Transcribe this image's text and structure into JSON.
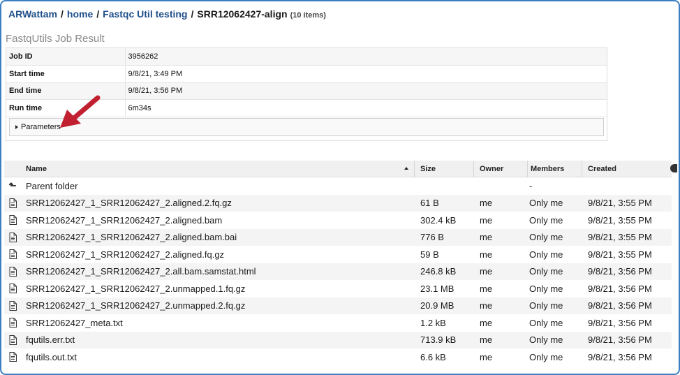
{
  "breadcrumb": {
    "user": "ARWattam",
    "sep": "/",
    "home": "home",
    "folder": "Fastqc Util testing",
    "current": "SRR12062427-align",
    "count": "(10 items)"
  },
  "job": {
    "title": "FastqUtils Job Result",
    "rows": [
      {
        "label": "Job ID",
        "value": "3956262"
      },
      {
        "label": "Start time",
        "value": "9/8/21, 3:49 PM"
      },
      {
        "label": "End time",
        "value": "9/8/21, 3:56 PM"
      },
      {
        "label": "Run time",
        "value": "6m34s"
      }
    ],
    "parameters_label": "Parameters"
  },
  "grid": {
    "headers": {
      "name": "Name",
      "size": "Size",
      "owner": "Owner",
      "members": "Members",
      "created": "Created"
    },
    "parent": {
      "name": "Parent folder",
      "members": "-"
    },
    "files": [
      {
        "name": "SRR12062427_1_SRR12062427_2.aligned.2.fq.gz",
        "size": "61 B",
        "owner": "me",
        "members": "Only me",
        "created": "9/8/21, 3:55 PM"
      },
      {
        "name": "SRR12062427_1_SRR12062427_2.aligned.bam",
        "size": "302.4 kB",
        "owner": "me",
        "members": "Only me",
        "created": "9/8/21, 3:55 PM"
      },
      {
        "name": "SRR12062427_1_SRR12062427_2.aligned.bam.bai",
        "size": "776 B",
        "owner": "me",
        "members": "Only me",
        "created": "9/8/21, 3:55 PM"
      },
      {
        "name": "SRR12062427_1_SRR12062427_2.aligned.fq.gz",
        "size": "59 B",
        "owner": "me",
        "members": "Only me",
        "created": "9/8/21, 3:55 PM"
      },
      {
        "name": "SRR12062427_1_SRR12062427_2.all.bam.samstat.html",
        "size": "246.8 kB",
        "owner": "me",
        "members": "Only me",
        "created": "9/8/21, 3:56 PM"
      },
      {
        "name": "SRR12062427_1_SRR12062427_2.unmapped.1.fq.gz",
        "size": "23.1 MB",
        "owner": "me",
        "members": "Only me",
        "created": "9/8/21, 3:56 PM"
      },
      {
        "name": "SRR12062427_1_SRR12062427_2.unmapped.2.fq.gz",
        "size": "20.9 MB",
        "owner": "me",
        "members": "Only me",
        "created": "9/8/21, 3:56 PM"
      },
      {
        "name": "SRR12062427_meta.txt",
        "size": "1.2 kB",
        "owner": "me",
        "members": "Only me",
        "created": "9/8/21, 3:56 PM"
      },
      {
        "name": "fqutils.err.txt",
        "size": "713.9 kB",
        "owner": "me",
        "members": "Only me",
        "created": "9/8/21, 3:56 PM"
      },
      {
        "name": "fqutils.out.txt",
        "size": "6.6 kB",
        "owner": "me",
        "members": "Only me",
        "created": "9/8/21, 3:56 PM"
      }
    ]
  },
  "colors": {
    "link": "#1f4f8a",
    "frame_border": "#3b7ec3",
    "annotation_arrow": "#c0202f"
  },
  "icons": {
    "file": "document-icon",
    "parent": "parent-folder-arrow-icon",
    "sort": "sort-ascending-icon",
    "settings": "gear-icon"
  }
}
